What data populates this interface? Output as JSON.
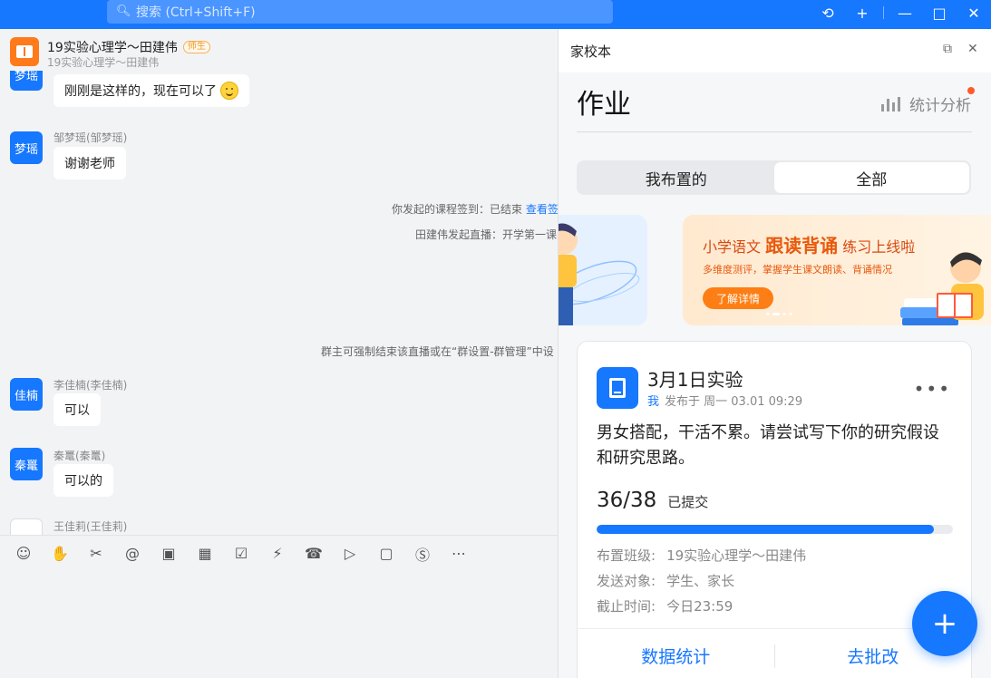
{
  "titlebar": {
    "search_placeholder": "搜索 (Ctrl+Shift+F)",
    "accent": "#1677ff"
  },
  "chat": {
    "group_title": "19实验心理学～田建伟",
    "group_tag": "师生",
    "group_subtitle": "19实验心理学～田建伟",
    "messages": [
      {
        "avatar": "梦瑶",
        "sender": "",
        "text": "刚刚是这样的，现在可以了"
      },
      {
        "avatar": "梦瑶",
        "sender": "邹梦瑶(邹梦瑶)",
        "text": "谢谢老师"
      },
      {
        "avatar": "佳楠",
        "sender": "李佳楠(李佳楠)",
        "text": "可以"
      },
      {
        "avatar": "秦鼍",
        "sender": "秦鼍(秦鼍)",
        "text": "可以的"
      },
      {
        "avatar": "",
        "sender": "王佳莉(王佳莉)",
        "text": ""
      }
    ],
    "system": {
      "checkin": "你发起的课程签到：已结束",
      "checkin_link": "查看签",
      "live": "田建伟发起直播：开学第一课",
      "notice": "群主可强制结束该直播或在“群设置-群管理”中设"
    },
    "toolbar_icons": [
      "emoji-icon",
      "thumbs-up-icon",
      "scissors-icon",
      "at-icon",
      "folder-add-icon",
      "calendar-icon",
      "checkbox-icon",
      "bolt-icon",
      "call-icon",
      "tv-icon",
      "present-icon",
      "school-icon",
      "more-icon"
    ]
  },
  "panel": {
    "title": "家校本",
    "page_title": "作业",
    "stats_label": "统计分析",
    "tabs": [
      {
        "label": "我布置的",
        "active": false
      },
      {
        "label": "全部",
        "active": true
      }
    ],
    "banner": {
      "prefix": "小学语文",
      "highlight": "跟读背诵",
      "suffix": "练习上线啦",
      "desc": "多维度测评，掌握学生课文朗读、背诵情况",
      "button": "了解详情"
    },
    "card": {
      "title": "3月1日实验",
      "me": "我",
      "published": "发布于 周一 03.01 09:29",
      "body": "男女搭配，干活不累。请尝试写下你的研究假设和研究思路。",
      "count": "36/38",
      "count_label": "已提交",
      "progress": 0.947,
      "class_label": "布置班级:",
      "class_value": "19实验心理学～田建伟",
      "target_label": "发送对象:",
      "target_value": "学生、家长",
      "deadline_label": "截止时间:",
      "deadline_value": "今日23:59",
      "btn_stats": "数据统计",
      "btn_grade": "去批改"
    }
  }
}
